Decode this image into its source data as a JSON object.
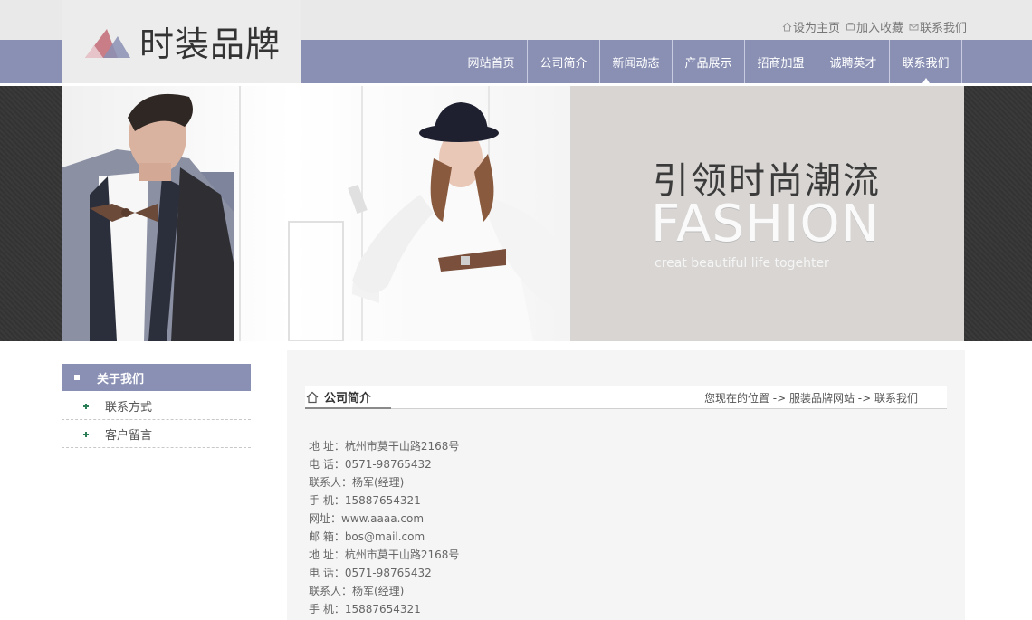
{
  "brand": {
    "name": "时装品牌",
    "colors": {
      "nav": "#8a90b4",
      "logo_pink": "#c97d86",
      "logo_blue": "#8a90b4"
    }
  },
  "top_links": [
    {
      "label": "设为主页",
      "icon": "home-icon"
    },
    {
      "label": "加入收藏",
      "icon": "favorite-icon"
    },
    {
      "label": "联系我们",
      "icon": "mail-icon"
    }
  ],
  "nav": [
    {
      "label": "网站首页"
    },
    {
      "label": "公司简介"
    },
    {
      "label": "新闻动态"
    },
    {
      "label": "产品展示"
    },
    {
      "label": "招商加盟"
    },
    {
      "label": "诚聘英才"
    },
    {
      "label": "联系我们",
      "active": true
    }
  ],
  "banner": {
    "slogan_cn": "引领时尚潮流",
    "slogan_en": "FASHION",
    "slogan_sub": "creat beautiful life togehter"
  },
  "sidebar": {
    "title": "关于我们",
    "items": [
      {
        "label": "联系方式"
      },
      {
        "label": "客户留言"
      }
    ]
  },
  "main": {
    "title": "公司简介",
    "breadcrumb": "您现在的位置 -> 服装品牌网站 -> 联系我们",
    "info_lines": [
      "地 址：杭州市莫干山路2168号",
      "电 话：0571-98765432",
      "联系人：杨军(经理)",
      "手 机：15887654321",
      "网址：www.aaaa.com",
      "邮 箱：bos@mail.com",
      "地 址：杭州市莫干山路2168号",
      "电 话：0571-98765432",
      "联系人：杨军(经理)",
      "手 机：15887654321"
    ]
  }
}
